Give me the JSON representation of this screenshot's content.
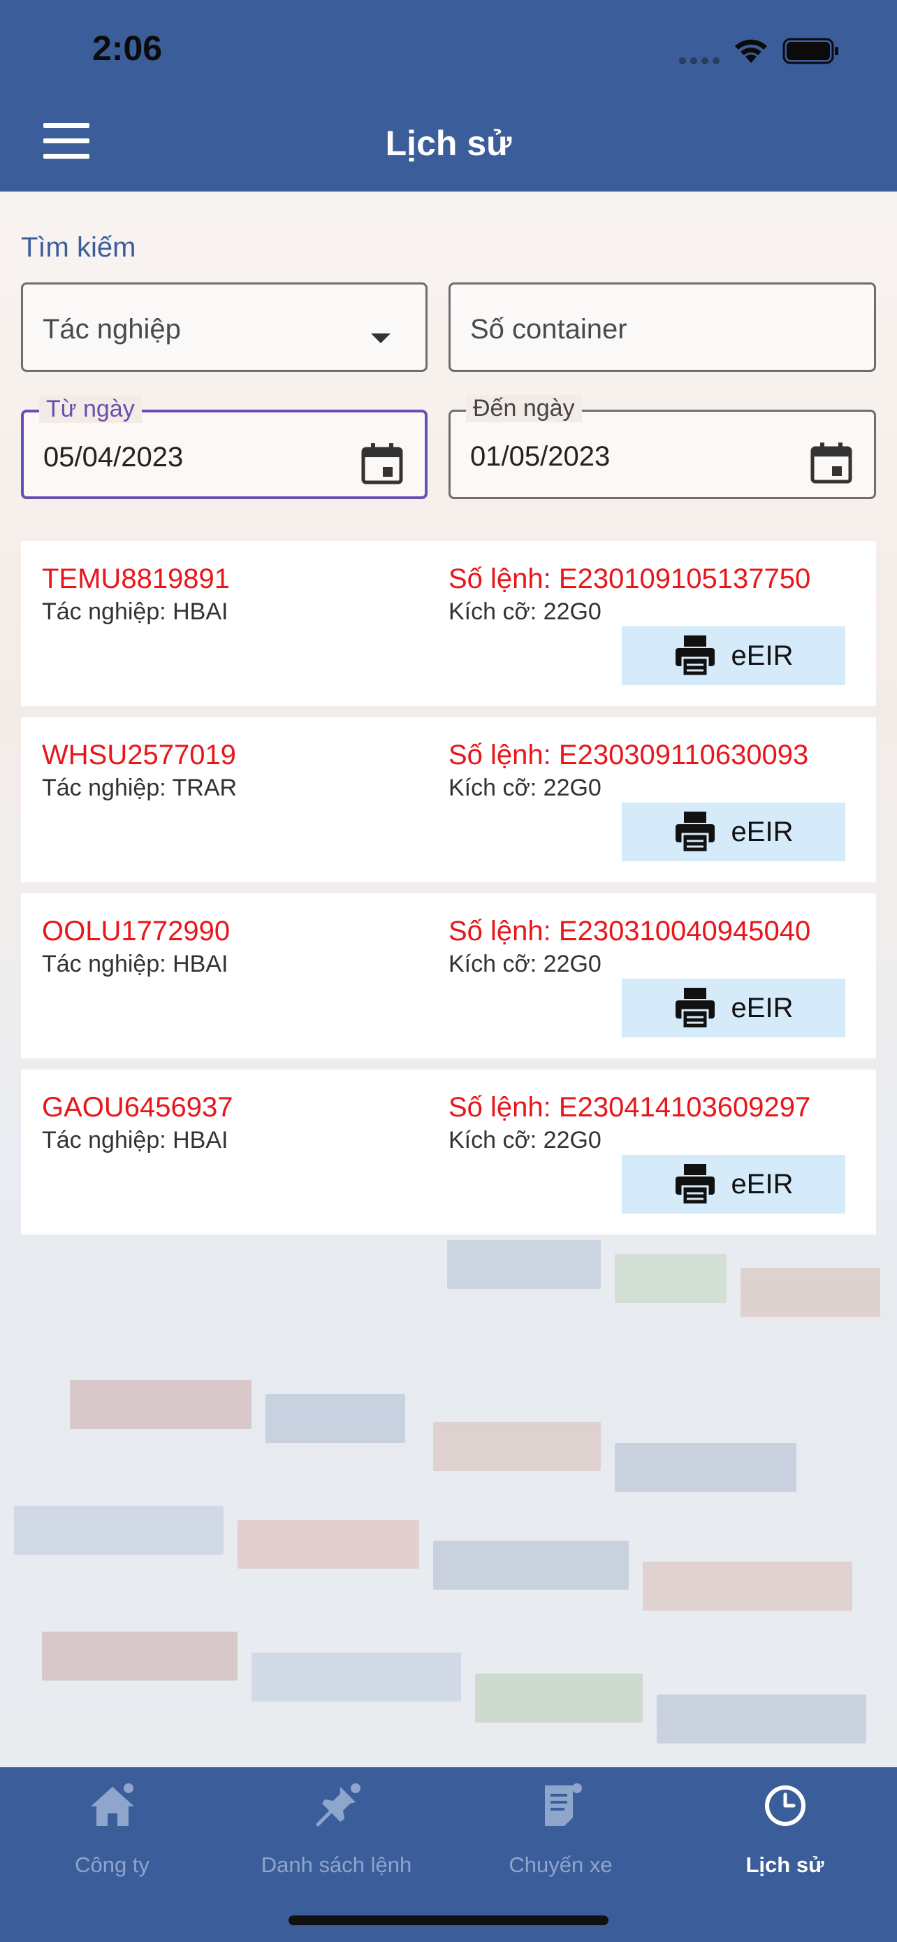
{
  "status_bar": {
    "time": "2:06"
  },
  "header": {
    "title": "Lịch sử"
  },
  "search": {
    "label": "Tìm kiếm",
    "operation_placeholder": "Tác nghiệp",
    "container_placeholder": "Số container",
    "from_date_label": "Từ ngày",
    "from_date_value": "05/04/2023",
    "to_date_label": "Đến ngày",
    "to_date_value": "01/05/2023"
  },
  "records": [
    {
      "container": "TEMU8819891",
      "operation": "Tác nghiệp: HBAI",
      "order_no": "Số lệnh: E230109105137750",
      "size": "Kích cỡ: 22G0",
      "button": "eEIR"
    },
    {
      "container": "WHSU2577019",
      "operation": "Tác nghiệp: TRAR",
      "order_no": "Số lệnh: E230309110630093",
      "size": "Kích cỡ: 22G0",
      "button": "eEIR"
    },
    {
      "container": "OOLU1772990",
      "operation": "Tác nghiệp: HBAI",
      "order_no": "Số lệnh: E230310040945040",
      "size": "Kích cỡ: 22G0",
      "button": "eEIR"
    },
    {
      "container": "GAOU6456937",
      "operation": "Tác nghiệp: HBAI",
      "order_no": "Số lệnh: E230414103609297",
      "size": "Kích cỡ: 22G0",
      "button": "eEIR"
    }
  ],
  "bottom_nav": {
    "items": [
      {
        "label": "Công ty",
        "icon": "home-icon"
      },
      {
        "label": "Danh sách lệnh",
        "icon": "pin-icon"
      },
      {
        "label": "Chuyến xe",
        "icon": "document-icon"
      },
      {
        "label": "Lịch sử",
        "icon": "clock-icon",
        "active": true
      }
    ]
  },
  "colors": {
    "primary": "#3b5e9a",
    "accent_red": "#e8161b",
    "focus_purple": "#6a4fb0",
    "button_bg": "#d6ebf9",
    "nav_inactive": "#8ea5cc"
  }
}
